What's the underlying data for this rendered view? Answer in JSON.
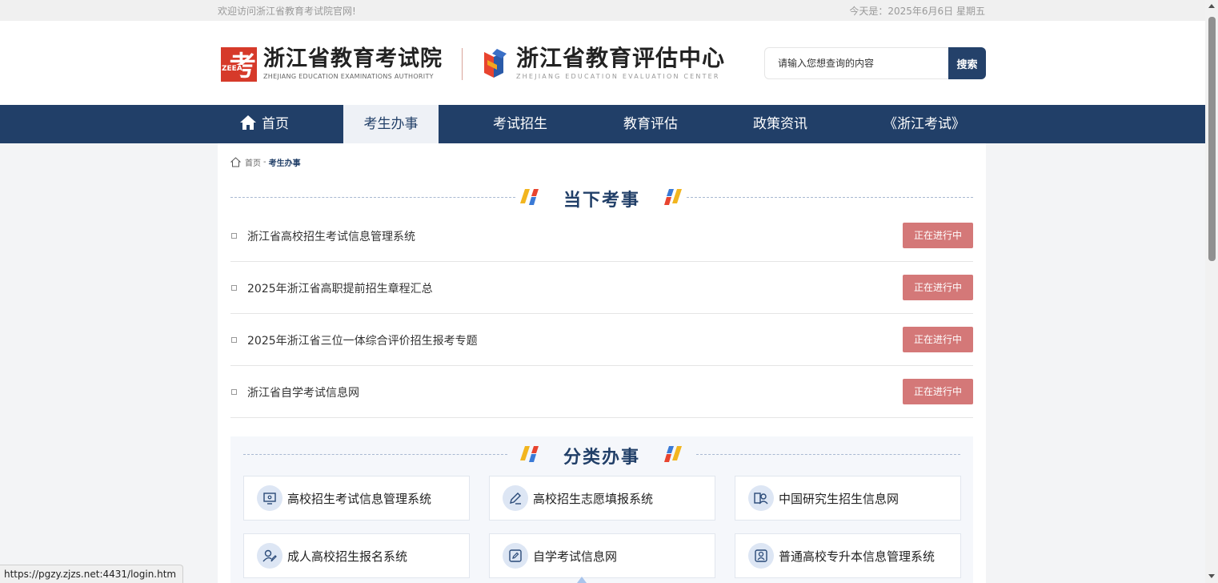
{
  "topbar": {
    "welcome": "欢迎访问浙江省教育考试院官网!",
    "date": "今天是：2025年6月6日 星期五"
  },
  "logo1": {
    "badge_char": "考",
    "badge_small": "ZEEA",
    "name_cn": "浙江省教育考试院",
    "name_en": "ZHEJIANG EDUCATION EXAMINATIONS AUTHORITY"
  },
  "logo2": {
    "name_cn": "浙江省教育评估中心",
    "name_en": "ZHEJIANG EDUCATION EVALUATION CENTER"
  },
  "search": {
    "placeholder": "请输入您想查询的内容",
    "button": "搜索"
  },
  "nav": {
    "items": [
      {
        "label": "首页"
      },
      {
        "label": "考生办事"
      },
      {
        "label": "考试招生"
      },
      {
        "label": "教育评估"
      },
      {
        "label": "政策资讯"
      },
      {
        "label": "《浙江考试》"
      }
    ],
    "active_index": 1
  },
  "breadcrumb": {
    "home": "首页",
    "separator": "-",
    "current": "考生办事"
  },
  "current_affairs": {
    "title": "当下考事",
    "items": [
      {
        "title": "浙江省高校招生考试信息管理系统",
        "status": "正在进行中"
      },
      {
        "title": "2025年浙江省高职提前招生章程汇总",
        "status": "正在进行中"
      },
      {
        "title": "2025年浙江省三位一体综合评价招生报考专题",
        "status": "正在进行中"
      },
      {
        "title": "浙江省自学考试信息网",
        "status": "正在进行中"
      }
    ]
  },
  "categories": {
    "title": "分类办事",
    "items": [
      {
        "label": "高校招生考试信息管理系统",
        "icon": "monitor-icon"
      },
      {
        "label": "高校招生志愿填报系统",
        "icon": "pencil-icon"
      },
      {
        "label": "中国研究生招生信息网",
        "icon": "graduate-icon"
      },
      {
        "label": "成人高校招生报名系统",
        "icon": "user-edit-icon"
      },
      {
        "label": "自学考试信息网",
        "icon": "edit-square-icon"
      },
      {
        "label": "普通高校专升本信息管理系统",
        "icon": "user-card-icon"
      }
    ]
  },
  "status_url": "https://pgzy.zjzs.net:4431/login.htm",
  "colors": {
    "nav_bg": "#213f68",
    "status_badge": "#d47878",
    "brand_red": "#d63a2a"
  }
}
